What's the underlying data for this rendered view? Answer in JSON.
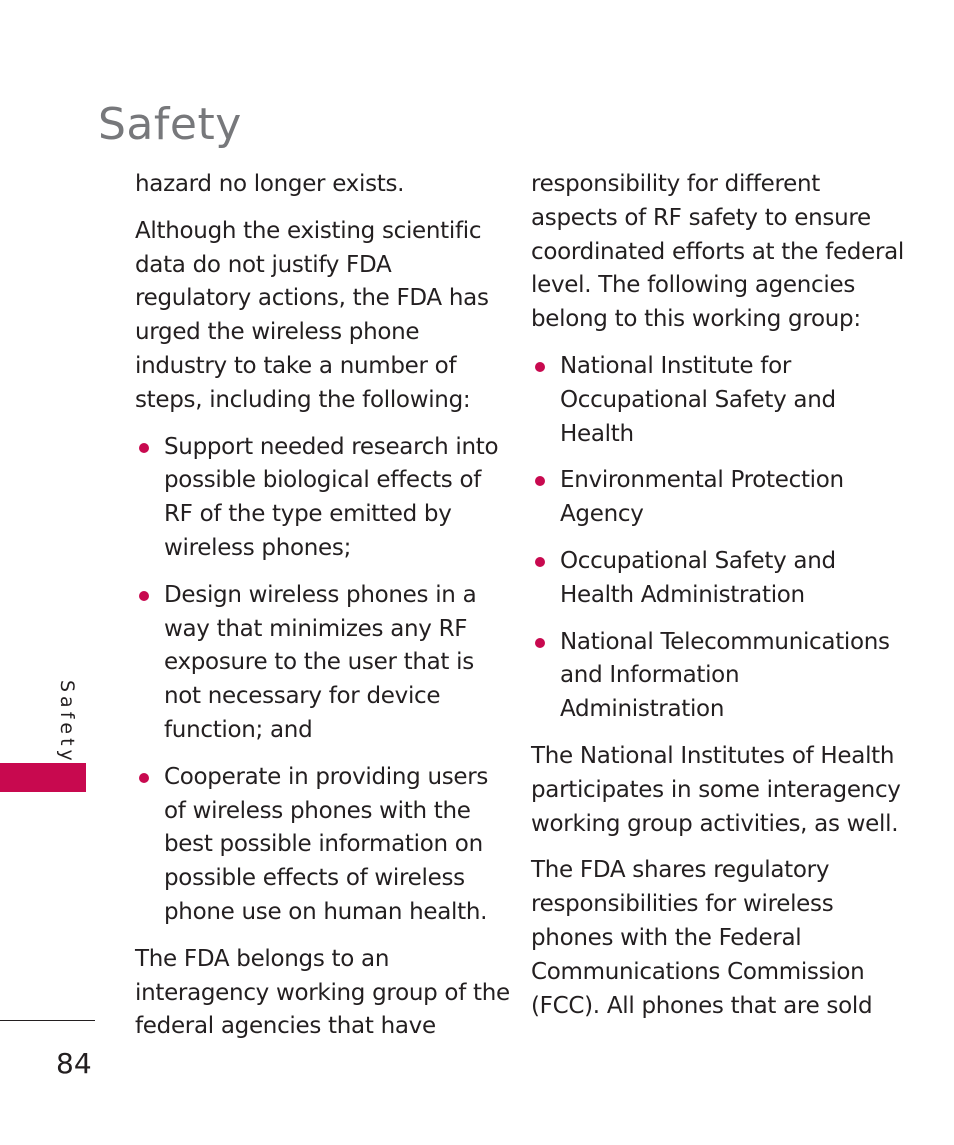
{
  "header": {
    "title": "Safety"
  },
  "sidebar": {
    "section_label": "Safety",
    "accent_color": "#c8094f"
  },
  "footer": {
    "page_number": "84"
  },
  "left_column": {
    "p1": [
      "hazard no longer exists."
    ],
    "p2": [
      "Although the existing scientific",
      "data do not justify FDA",
      "regulatory actions, the FDA has",
      "urged the wireless phone",
      "industry to take a number of",
      "steps, including the following:"
    ],
    "bullets": [
      {
        "lines": [
          "Support needed research into",
          "possible biological effects of",
          "RF of the type emitted by",
          "wireless phones;"
        ]
      },
      {
        "lines": [
          "Design wireless phones in a",
          "way that minimizes any RF",
          "exposure to the user that is",
          "not necessary for device",
          "function; and"
        ]
      },
      {
        "lines": [
          "Cooperate in providing users",
          "of wireless phones with the",
          "best possible information on",
          "possible effects of wireless",
          "phone use on human health."
        ]
      }
    ],
    "p3": [
      "The FDA belongs to an",
      "interagency working group of the",
      "federal agencies that have"
    ]
  },
  "right_column": {
    "p1": [
      "responsibility for different",
      "aspects of RF safety to ensure",
      "coordinated efforts at the federal",
      "level. The following agencies",
      "belong to this working group:"
    ],
    "bullets": [
      {
        "lines": [
          "National Institute for",
          "Occupational Safety and",
          "Health"
        ]
      },
      {
        "lines": [
          "Environmental Protection",
          "Agency"
        ]
      },
      {
        "lines": [
          "Occupational Safety and",
          "Health Administration"
        ]
      },
      {
        "lines": [
          "National Telecommunications",
          "and Information",
          "Administration"
        ]
      }
    ],
    "p2": [
      "The National Institutes of Health",
      "participates in some interagency",
      "working group activities, as well."
    ],
    "p3": [
      "The FDA shares regulatory",
      "responsibilities for wireless",
      "phones with the Federal",
      "Communications Commission",
      "(FCC). All phones that are sold"
    ]
  }
}
